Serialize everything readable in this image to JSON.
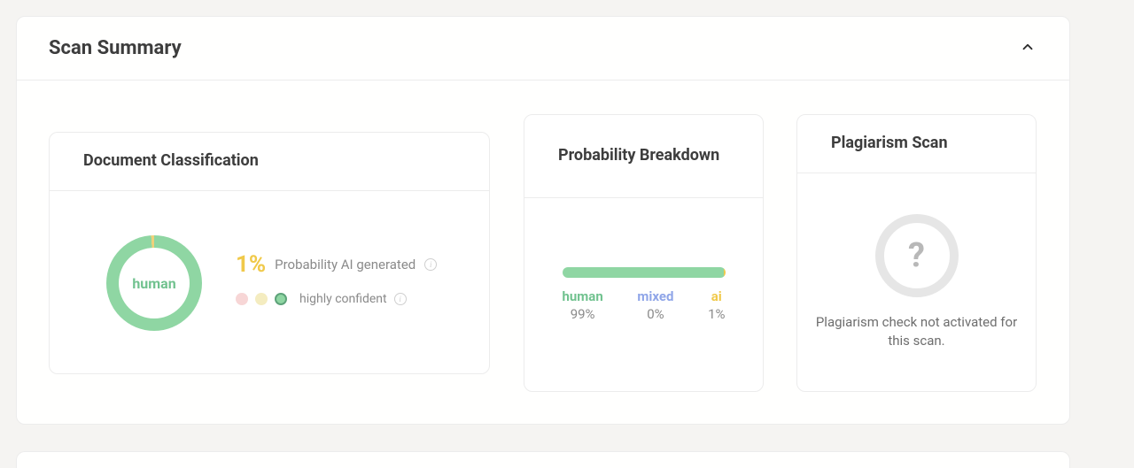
{
  "summary": {
    "title": "Scan Summary"
  },
  "doc_classification": {
    "title": "Document Classification",
    "ring_label": "human",
    "percent": "1%",
    "percent_label": "Probability AI generated",
    "confidence": "highly confident"
  },
  "probability": {
    "title": "Probability Breakdown",
    "human_label": "human",
    "human_pct": "99%",
    "mixed_label": "mixed",
    "mixed_pct": "0%",
    "ai_label": "ai",
    "ai_pct": "1%"
  },
  "plagiarism": {
    "title": "Plagiarism Scan",
    "placeholder": "?",
    "message": "Plagiarism check not activated for this scan."
  },
  "chart_data": [
    {
      "type": "pie",
      "title": "Document Classification",
      "series": [
        {
          "name": "human",
          "value": 99
        },
        {
          "name": "ai",
          "value": 1
        }
      ],
      "colors": {
        "human": "#8fd6a3",
        "ai": "#f0c94a"
      }
    },
    {
      "type": "bar",
      "title": "Probability Breakdown",
      "categories": [
        "human",
        "mixed",
        "ai"
      ],
      "values": [
        99,
        0,
        1
      ],
      "colors": {
        "human": "#8fd6a3",
        "mixed": "#8fa5e8",
        "ai": "#f0c94a"
      },
      "xlabel": "",
      "ylabel": "%",
      "ylim": [
        0,
        100
      ]
    }
  ]
}
